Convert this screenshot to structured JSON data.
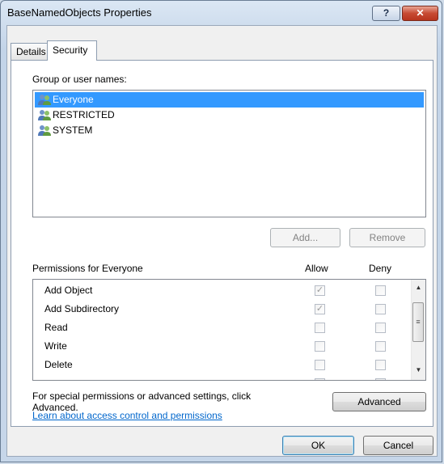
{
  "window": {
    "title": "BaseNamedObjects Properties",
    "help_label": "?",
    "close_label": "✕"
  },
  "tabs": [
    {
      "label": "Details",
      "active": false
    },
    {
      "label": "Security",
      "active": true
    }
  ],
  "security": {
    "group_label": "Group or user names:",
    "users": [
      {
        "name": "Everyone",
        "selected": true,
        "icon": "user-group-icon"
      },
      {
        "name": "RESTRICTED",
        "selected": false,
        "icon": "user-group-icon"
      },
      {
        "name": "SYSTEM",
        "selected": false,
        "icon": "user-group-icon"
      }
    ],
    "add_label": "Add...",
    "remove_label": "Remove",
    "permissions_label": "Permissions for Everyone",
    "allow_header": "Allow",
    "deny_header": "Deny",
    "permissions": [
      {
        "name": "Add Object",
        "allow": true,
        "deny": false
      },
      {
        "name": "Add Subdirectory",
        "allow": true,
        "deny": false
      },
      {
        "name": "Read",
        "allow": false,
        "deny": false
      },
      {
        "name": "Write",
        "allow": false,
        "deny": false
      },
      {
        "name": "Delete",
        "allow": false,
        "deny": false
      }
    ],
    "special_text_line1": "For special permissions or advanced settings, click",
    "special_text_line2": "Advanced.",
    "advanced_label": "Advanced",
    "learn_link": "Learn about access control and permissions"
  },
  "footer": {
    "ok_label": "OK",
    "cancel_label": "Cancel"
  },
  "colors": {
    "selection": "#3399ff",
    "link": "#0066cc",
    "close_button": "#c74a33"
  }
}
